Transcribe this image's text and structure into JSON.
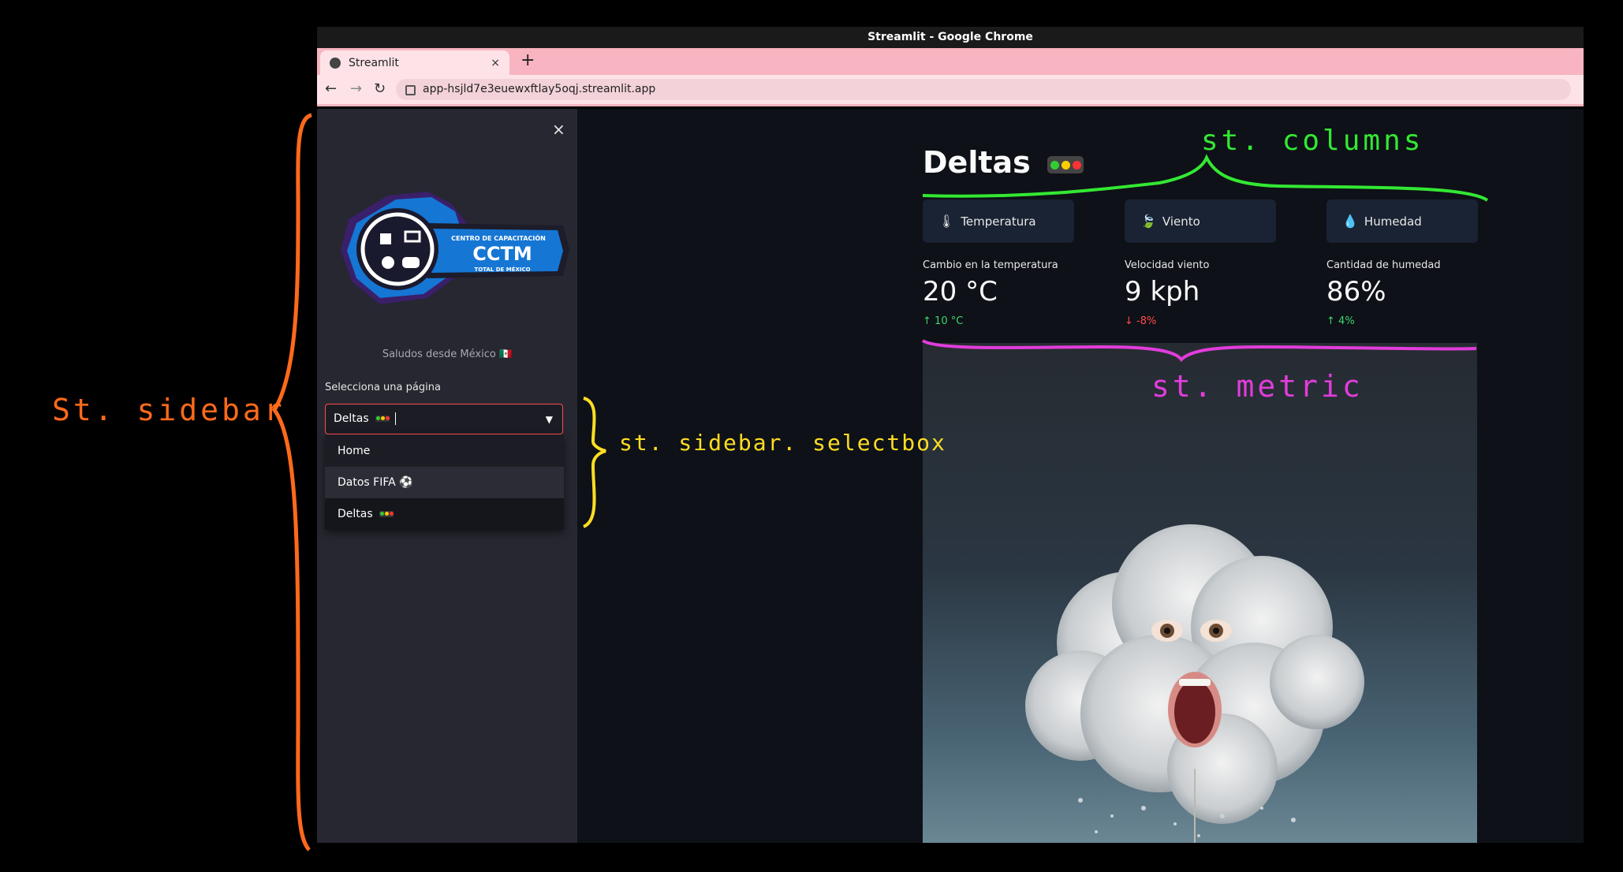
{
  "window": {
    "title": "Streamlit - Google Chrome"
  },
  "browser": {
    "tab_label": "Streamlit",
    "tab_close": "×",
    "new_tab": "+",
    "url": "app-hsjld7e3euewxftlay5oqj.streamlit.app"
  },
  "sidebar": {
    "close": "×",
    "logo_text_top": "CENTRO DE CAPACITACIÓN",
    "logo_text_main": "CCTM",
    "logo_text_bottom": "TOTAL DE MÉXICO",
    "greeting": "Saludos desde México 🇲🇽",
    "select_label": "Selecciona una página",
    "select_value": "Deltas",
    "options": [
      "Home",
      "Datos FIFA ⚽",
      "Deltas"
    ]
  },
  "main": {
    "title": "Deltas",
    "columns": [
      {
        "icon": "🌡",
        "label": "Temperatura"
      },
      {
        "icon": "🍃",
        "label": "Viento"
      },
      {
        "icon": "💧",
        "label": "Humedad"
      }
    ],
    "metrics": [
      {
        "label": "Cambio en la temperatura",
        "value": "20 °C",
        "delta": "10 °C",
        "direction": "up"
      },
      {
        "label": "Velocidad viento",
        "value": "9 kph",
        "delta": "-8%",
        "direction": "down"
      },
      {
        "label": "Cantidad de humedad",
        "value": "86%",
        "delta": "4%",
        "direction": "up"
      }
    ]
  },
  "annotations": {
    "sidebar": "St. sidebar",
    "selectbox": "st. sidebar. selectbox",
    "columns": "st. columns",
    "metric": "st. metric"
  },
  "colors": {
    "annotation_orange": "#ff6a1a",
    "annotation_yellow": "#ffdd22",
    "annotation_green": "#33e833",
    "annotation_magenta": "#e23cdc",
    "delta_up": "#3dd56d",
    "delta_down": "#ff4b4b"
  }
}
